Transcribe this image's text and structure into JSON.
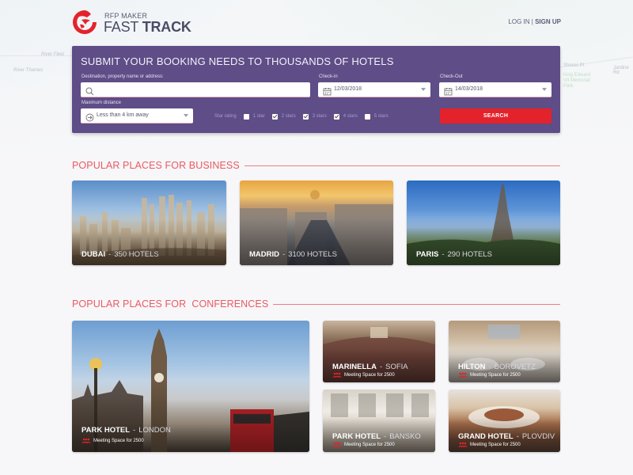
{
  "map": {
    "labels": [
      "River Fleet",
      "River Thames",
      "King Edward VII Memorial Park",
      "Jardine Rd",
      "Shores Pl"
    ]
  },
  "header": {
    "brand_small": "RFP MAKER",
    "brand_light": "FAST",
    "brand_bold": "TRACK",
    "login_label": "LOG IN",
    "separator": "|",
    "signup_label": "SIGN UP",
    "logo_icon": "eagle-logo-icon",
    "brand_color": "#e4222b"
  },
  "booking": {
    "title": "SUBMIT YOUR BOOKING NEEDS TO THOUSANDS OF HOTELS",
    "panel_color": "#5e4d86",
    "destination": {
      "label": "Destination, property name or address:",
      "value": "",
      "placeholder": "",
      "icon": "search-icon"
    },
    "checkin": {
      "label": "Check-in",
      "value": "12/03/2018",
      "icon": "calendar-icon"
    },
    "checkout": {
      "label": "Check-Out",
      "value": "14/03/2018",
      "icon": "calendar-icon"
    },
    "distance": {
      "label": "Maximum distance",
      "value": "Less than 4 km away",
      "icon": "arrow-circle-icon"
    },
    "star_rating": {
      "label": "Star rating",
      "options": [
        {
          "label": "1 star",
          "checked": false
        },
        {
          "label": "2 stars",
          "checked": true
        },
        {
          "label": "3 stars",
          "checked": true
        },
        {
          "label": "4 stars",
          "checked": true
        },
        {
          "label": "5 stars",
          "checked": false
        }
      ]
    },
    "search_label": "SEARCH",
    "search_color": "#e4222b"
  },
  "business": {
    "heading": "POPULAR PLACES FOR BUSINESS",
    "accent": "#ea5a62",
    "cards": [
      {
        "city": "DUBAI",
        "count": "350 HOTELS"
      },
      {
        "city": "MADRID",
        "count": "3100 HOTELS"
      },
      {
        "city": "PARIS",
        "count": "290 HOTELS"
      }
    ]
  },
  "conferences": {
    "heading": "POPULAR PLACES FOR  CONFERENCES",
    "cards": [
      {
        "hotel": "PARK HOTEL",
        "city": "LONDON",
        "meeting": "Meeting Space for 2500"
      },
      {
        "hotel": "MARINELLA",
        "city": "SOFIA",
        "meeting": "Meeting Space for 2500"
      },
      {
        "hotel": "HILTON",
        "city": "BOROVETZ",
        "meeting": "Meeting Space for 2500"
      },
      {
        "hotel": "PARK HOTEL",
        "city": "BANSKO",
        "meeting": "Meeting Space for 2500"
      },
      {
        "hotel": "GRAND HOTEL",
        "city": "PLOVDIV",
        "meeting": "Meeting Space for 2500"
      }
    ]
  }
}
